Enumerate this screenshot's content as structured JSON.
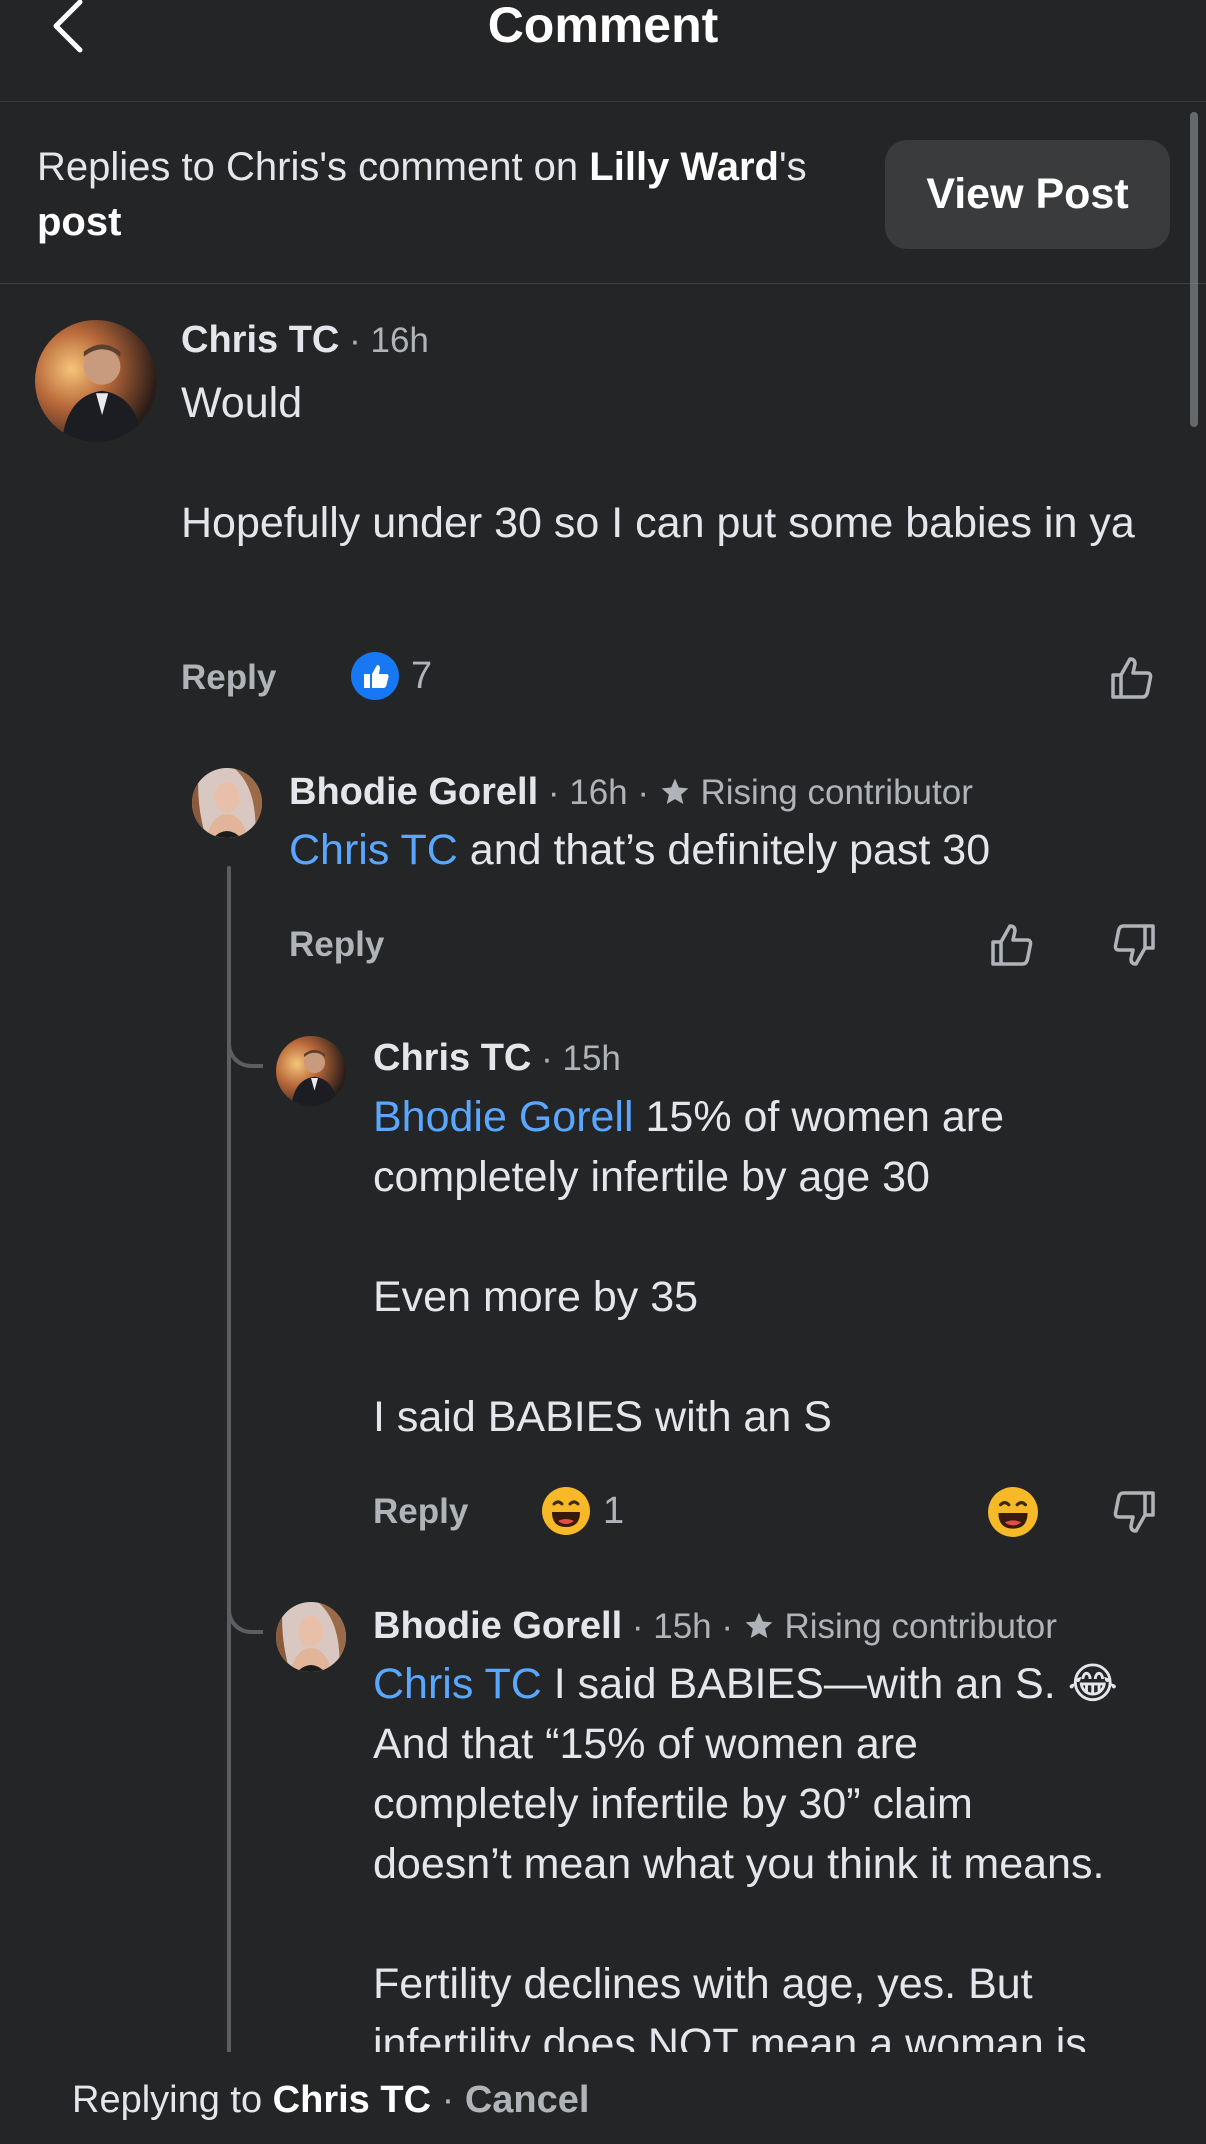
{
  "header": {
    "title": "Comment"
  },
  "context": {
    "prefix": "Replies to Chris's comment on ",
    "post_owner": "Lilly Ward",
    "suffix_possessive": "'s ",
    "post_word": "post",
    "view_post_label": "View Post"
  },
  "comments": [
    {
      "author": "Chris TC",
      "time": "· 16h",
      "paragraphs": [
        "Would",
        "Hopefully under 30 so I can put some babies in ya"
      ],
      "reply_label": "Reply",
      "reaction_count": "7",
      "reaction_icon": "like-reaction-icon"
    },
    {
      "author": "Bhodie Gorell",
      "time": "· 16h ·",
      "badge": "Rising contributor",
      "mention": "Chris TC",
      "text": " and that’s definitely past 30",
      "reply_label": "Reply"
    },
    {
      "author": "Chris TC",
      "time": "· 15h",
      "mention": "Bhodie Gorell",
      "paragraphs": [
        "15% of women are completely infertile by age 30",
        "Even more by 35",
        "I said BABIES with an S"
      ],
      "reply_label": "Reply",
      "reaction_count": "1",
      "reaction_icon": "haha-reaction-icon"
    },
    {
      "author": "Bhodie Gorell",
      "time": "· 15h ·",
      "badge": "Rising contributor",
      "mention": "Chris TC",
      "paragraphs": [
        " I said BABIES—with an S. 😂",
        "And that “15% of women are",
        "completely infertile by 30” claim",
        "doesn’t mean what you think it means.",
        "Fertility declines with age, yes. But",
        "infertility does NOT mean a woman is"
      ]
    }
  ],
  "composer": {
    "prefix": "Replying to ",
    "name": "Chris TC",
    "separator": " · ",
    "cancel": "Cancel"
  },
  "colors": {
    "background": "#242526",
    "mention": "#5aa7ff",
    "like_blue": "#1877f2",
    "secondary_text": "#b0b3b8"
  }
}
